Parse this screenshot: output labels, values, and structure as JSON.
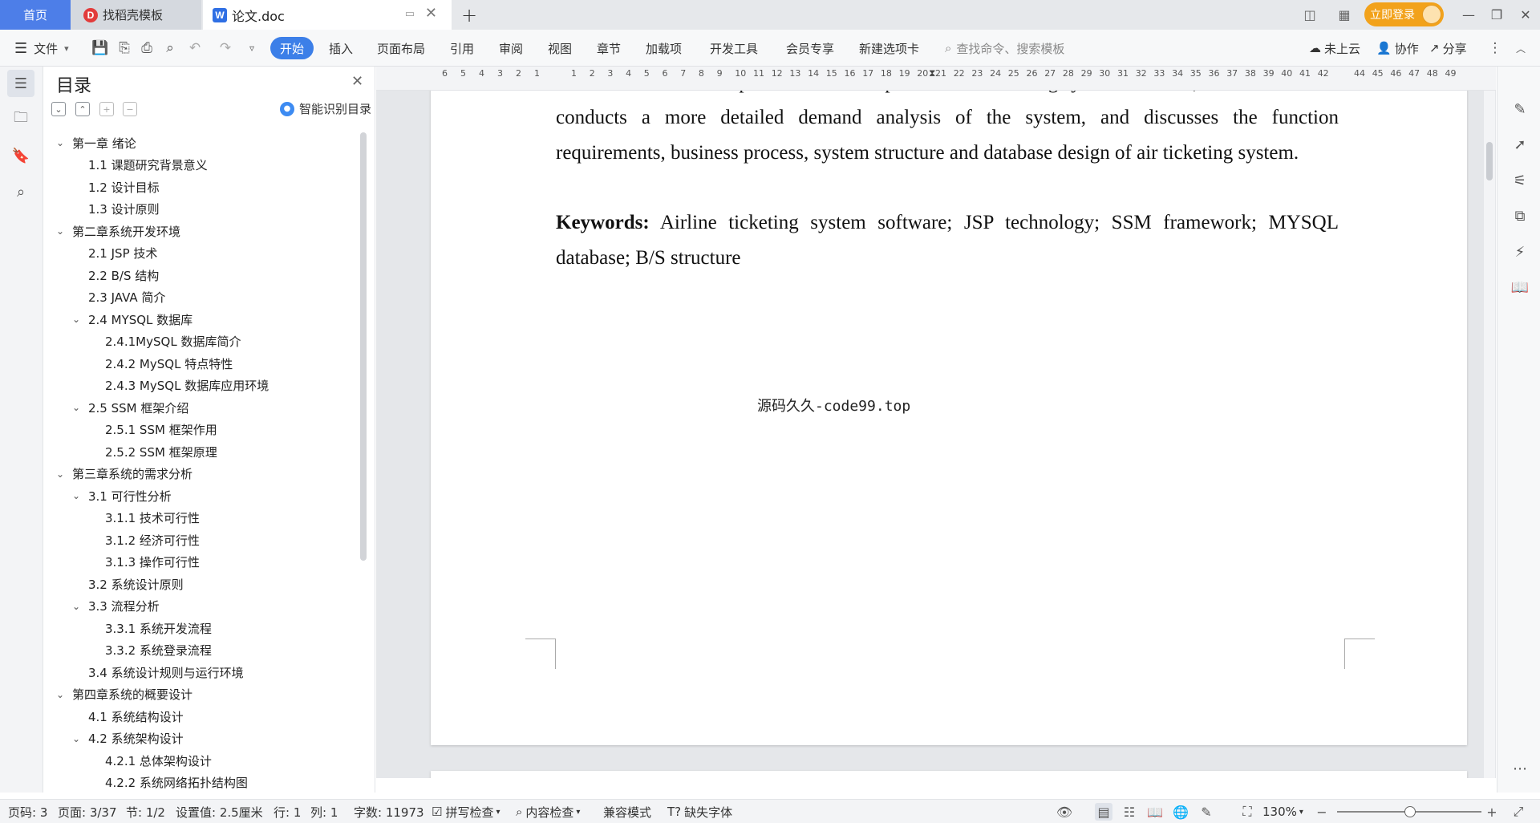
{
  "tabs": {
    "home": "首页",
    "template": "找稻壳模板",
    "doc": "论文.doc"
  },
  "titlebar": {
    "login": "立即登录"
  },
  "ribbon": {
    "file": "文件",
    "start": "开始",
    "menus": [
      "插入",
      "页面布局",
      "引用",
      "审阅",
      "视图",
      "章节",
      "加载项",
      "开发工具",
      "会员专享",
      "新建选项卡"
    ],
    "search_placeholder": "查找命令、搜索模板",
    "cloud": "未上云",
    "collab": "协作",
    "share": "分享"
  },
  "toc": {
    "title": "目录",
    "smart": "智能识别目录",
    "items": [
      {
        "label": "第一章  绪论",
        "level": 1,
        "expanded": true
      },
      {
        "label": "1.1 课题研究背景意义",
        "level": 2
      },
      {
        "label": "1.2 设计目标",
        "level": 2
      },
      {
        "label": "1.3  设计原则",
        "level": 2
      },
      {
        "label": "第二章系统开发环境",
        "level": 1,
        "expanded": true
      },
      {
        "label": "2.1 JSP 技术",
        "level": 2
      },
      {
        "label": "2.2 B/S 结构",
        "level": 2
      },
      {
        "label": "2.3 JAVA 简介",
        "level": 2
      },
      {
        "label": "2.4 MYSQL 数据库",
        "level": 2,
        "expanded": true
      },
      {
        "label": "2.4.1MySQL 数据库简介",
        "level": 3
      },
      {
        "label": "2.4.2 MySQL 特点特性",
        "level": 3
      },
      {
        "label": "2.4.3 MySQL 数据库应用环境",
        "level": 3
      },
      {
        "label": "2.5 SSM 框架介绍",
        "level": 2,
        "expanded": true
      },
      {
        "label": "2.5.1 SSM 框架作用",
        "level": 3
      },
      {
        "label": "2.5.2 SSM 框架原理",
        "level": 3
      },
      {
        "label": "第三章系统的需求分析",
        "level": 1,
        "expanded": true
      },
      {
        "label": "3.1 可行性分析",
        "level": 2,
        "expanded": true
      },
      {
        "label": "3.1.1  技术可行性",
        "level": 3
      },
      {
        "label": "3.1.2 经济可行性",
        "level": 3
      },
      {
        "label": "3.1.3 操作可行性",
        "level": 3
      },
      {
        "label": "3.2 系统设计原则",
        "level": 2
      },
      {
        "label": "3.3 流程分析",
        "level": 2,
        "expanded": true
      },
      {
        "label": "3.3.1  系统开发流程",
        "level": 3
      },
      {
        "label": "3.3.2  系统登录流程",
        "level": 3
      },
      {
        "label": "3.4 系统设计规则与运行环境",
        "level": 2
      },
      {
        "label": "第四章系统的概要设计",
        "level": 1,
        "expanded": true
      },
      {
        "label": "4.1  系统结构设计",
        "level": 2
      },
      {
        "label": "4.2  系统架构设计",
        "level": 2,
        "expanded": true
      },
      {
        "label": "4.2.1 总体架构设计",
        "level": 3
      },
      {
        "label": "4.2.2 系统网络拓扑结构图",
        "level": 3
      }
    ]
  },
  "ruler": {
    "left_numbers": [
      "6",
      "5",
      "4",
      "3",
      "2",
      "1"
    ],
    "right_numbers": [
      "1",
      "2",
      "3",
      "4",
      "5",
      "6",
      "7",
      "8",
      "9",
      "10",
      "11",
      "12",
      "13",
      "14",
      "15",
      "16",
      "17",
      "18",
      "19",
      "20",
      "21",
      "22",
      "23",
      "24",
      "25",
      "26",
      "27",
      "28",
      "29",
      "30",
      "31",
      "32",
      "33",
      "34",
      "35",
      "36",
      "37",
      "38",
      "39",
      "40",
      "41",
      "42"
    ],
    "tail_numbers": [
      "44",
      "45",
      "46",
      "47",
      "48",
      "49"
    ]
  },
  "document": {
    "clipped_line": "The thesis first expounds the development of air ticketing system software, and",
    "paragraph": "conducts a more detailed demand analysis of the system, and discusses the function requirements, business process, system structure and database design of air ticketing system.",
    "keywords_label": "Keywords:",
    "keywords_text": " Airline ticketing system software; JSP technology; SSM framework; MYSQL database; B/S structure",
    "watermark": "源码久久-code99.top"
  },
  "status": {
    "page_code": "页码: 3",
    "page": "页面: 3/37",
    "section": "节: 1/2",
    "setting": "设置值: 2.5厘米",
    "row": "行: 1",
    "col": "列: 1",
    "words": "字数: 11973",
    "spell": "拼写检查",
    "content_check": "内容检查",
    "compat": "兼容模式",
    "missing_font": "缺失字体",
    "zoom": "130%"
  },
  "colors": {
    "accent": "#3c7fe8",
    "home_tab": "#4d7ee8",
    "login": "#f2a21b"
  }
}
